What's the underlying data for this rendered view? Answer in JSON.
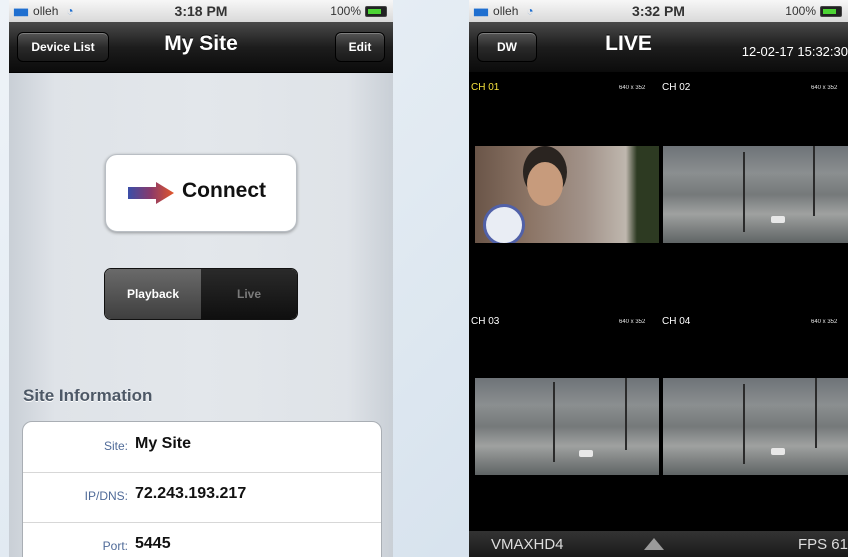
{
  "left": {
    "status": {
      "carrier": "olleh",
      "time": "3:18 PM",
      "battery": "100%"
    },
    "nav": {
      "back_label": "Device List",
      "title": "My Site",
      "edit_label": "Edit"
    },
    "connect_label": "Connect",
    "mode": {
      "playback": "Playback",
      "live": "Live"
    },
    "section_title": "Site Information",
    "info": [
      {
        "key": "Site:",
        "value": "My Site"
      },
      {
        "key": "IP/DNS:",
        "value": "72.243.193.217"
      },
      {
        "key": "Port:",
        "value": "5445"
      }
    ]
  },
  "right": {
    "status": {
      "carrier": "olleh",
      "time": "3:32 PM",
      "battery": "100%"
    },
    "nav": {
      "back_label": "DW",
      "title": "LIVE",
      "datetime": "12-02-17 15:32:30"
    },
    "channels": [
      {
        "label": "CH 01",
        "res": "640 x 352"
      },
      {
        "label": "CH 02",
        "res": "640 x 352"
      },
      {
        "label": "CH 03",
        "res": "640 x 352"
      },
      {
        "label": "CH 04",
        "res": "640 x 352"
      }
    ],
    "footer": {
      "device": "VMAXHD4",
      "fps": "FPS 61"
    }
  },
  "colors": {
    "accent_blue": "#1f6fd0",
    "channel_highlight": "#f5e13c"
  }
}
